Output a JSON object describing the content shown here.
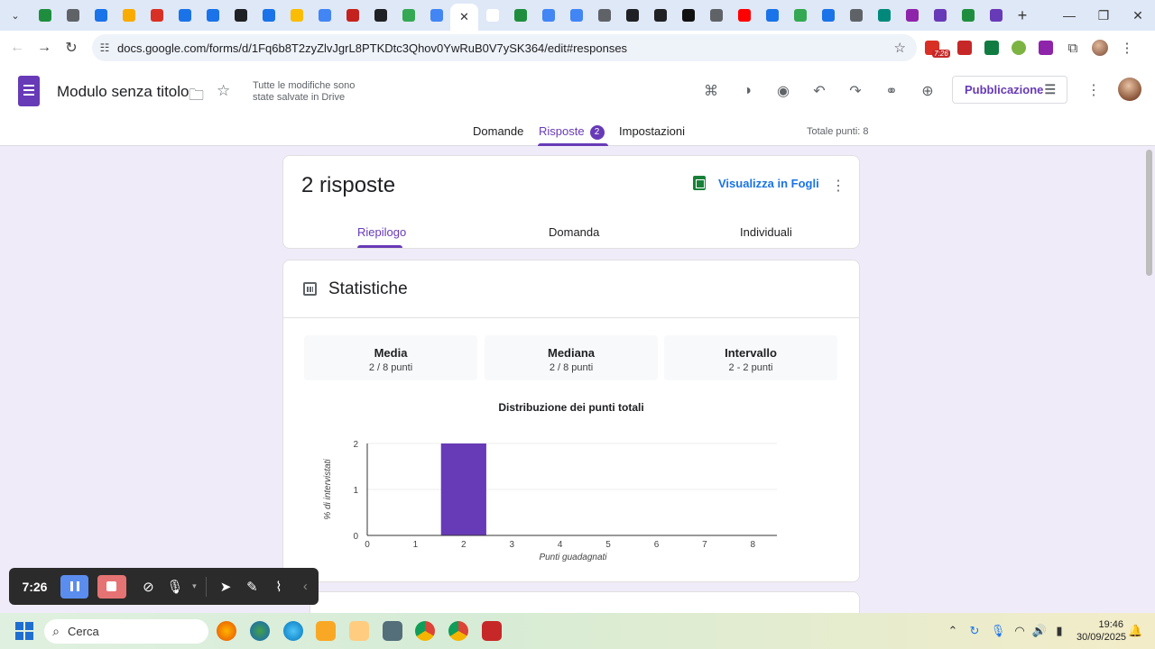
{
  "browser": {
    "url": "docs.google.com/forms/d/1Fq6b8T2zyZlvJgrL8PTKDtc3Qhov0YwRuB0V7ySK364/edit#responses",
    "extension_badge": "7:26",
    "tab_favicon_colors": [
      "#1e8e3e",
      "#5f6368",
      "#1a73e8",
      "#f9ab00",
      "#d93025",
      "#1a73e8",
      "#1a73e8",
      "#202124",
      "#1a73e8",
      "#fbbc04",
      "#4285f4",
      "#c5221f",
      "#202124",
      "#34a853",
      "#4285f4",
      "#ffffff",
      "#1e8e3e",
      "#4285f4",
      "#4285f4",
      "#5f6368",
      "#202124",
      "#202124",
      "#111111",
      "#5f6368",
      "#ff0000",
      "#1a73e8",
      "#34a853",
      "#1a73e8",
      "#5f6368",
      "#00897b",
      "#8e24aa",
      "#673ab7",
      "#1e8e3e",
      "#673ab7"
    ]
  },
  "form": {
    "title": "Modulo senza titolo",
    "save_status": "Tutte le modifiche sono state salvate in Drive",
    "publish_label": "Pubblicazione",
    "tabs": [
      {
        "label": "Domande"
      },
      {
        "label": "Risposte",
        "badge": "2"
      },
      {
        "label": "Impostazioni"
      }
    ],
    "total_points": "Totale punti: 8"
  },
  "responses": {
    "title": "2 risposte",
    "sheets_link": "Visualizza in Fogli",
    "subtabs": [
      "Riepilogo",
      "Domanda",
      "Individuali"
    ]
  },
  "stats": {
    "title": "Statistiche",
    "metrics": [
      {
        "label": "Media",
        "value": "2 / 8 punti"
      },
      {
        "label": "Mediana",
        "value": "2 / 8 punti"
      },
      {
        "label": "Intervallo",
        "value": "2 - 2 punti"
      }
    ]
  },
  "chart_data": {
    "type": "bar",
    "title": "Distribuzione dei punti totali",
    "xlabel": "Punti guadagnati",
    "ylabel": "% di intervistati",
    "categories": [
      "0",
      "1",
      "2",
      "3",
      "4",
      "5",
      "6",
      "7",
      "8"
    ],
    "values": [
      0,
      0,
      2,
      0,
      0,
      0,
      0,
      0,
      0
    ],
    "yticks": [
      "0",
      "1",
      "2"
    ],
    "ylim": [
      0,
      2
    ],
    "color": "#673ab7",
    "grid": true
  },
  "recorder": {
    "time": "7:26"
  },
  "taskbar": {
    "search_placeholder": "Cerca",
    "time": "19:46",
    "date": "30/09/2025"
  },
  "colors": {
    "accent": "#673ab7",
    "link": "#1a73e8",
    "background": "#f0ebf8"
  }
}
